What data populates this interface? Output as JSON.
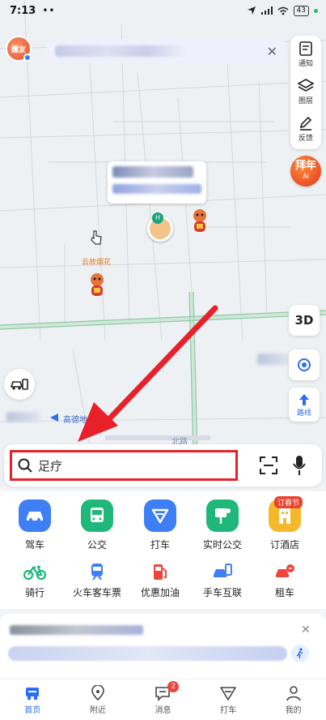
{
  "status_bar": {
    "time": "7:13",
    "dots": "••",
    "battery": "43"
  },
  "header": {
    "avatar_text": "醒友"
  },
  "right_panel": {
    "notify_label": "通知",
    "layers_label": "图层",
    "feedback_label": "反馈"
  },
  "promo": {
    "title": "拜年",
    "sub": "AI"
  },
  "map": {
    "poi_badge": "H",
    "label_cloud": "云故烟花",
    "gaode_text": "高德地",
    "road_text": "北路"
  },
  "controls": {
    "btn_3d": "3D",
    "route_label": "路线"
  },
  "search": {
    "text": "足疗"
  },
  "services_main": [
    {
      "label": "驾车",
      "color": "#3e7ff5"
    },
    {
      "label": "公交",
      "color": "#1fb87a"
    },
    {
      "label": "打车",
      "color": "#3e7ff5"
    },
    {
      "label": "实时公交",
      "color": "#1fb87a"
    },
    {
      "label": "订酒店",
      "color": "#f5b82a"
    }
  ],
  "hotel_badge": "订春节",
  "services_sub": [
    {
      "label": "骑行",
      "color": "#1fb87a"
    },
    {
      "label": "火车客车票",
      "color": "#3e7ff5"
    },
    {
      "label": "优惠加油",
      "color": "#f0443a"
    },
    {
      "label": "手车互联",
      "color": "#3e7ff5"
    },
    {
      "label": "租车",
      "color": "#f0443a"
    }
  ],
  "tabs": [
    {
      "label": "首页",
      "active": true
    },
    {
      "label": "附近"
    },
    {
      "label": "消息",
      "badge": "2"
    },
    {
      "label": "打车"
    },
    {
      "label": "我的"
    }
  ],
  "colors": {
    "accent": "#2c6ef2",
    "annotation_red": "#e8202a"
  }
}
